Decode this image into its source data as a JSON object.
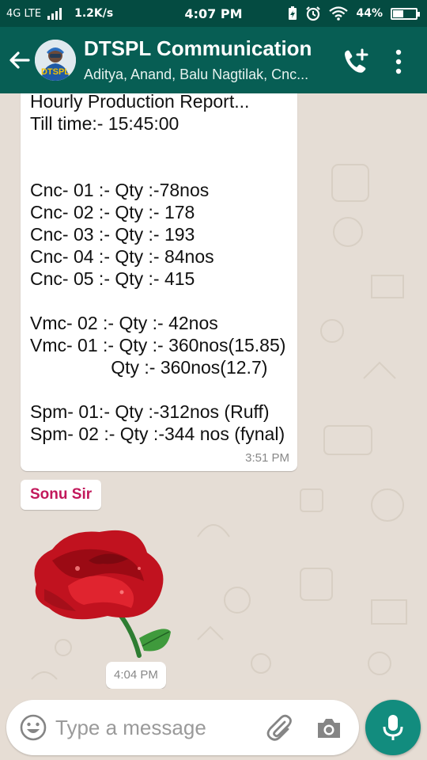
{
  "status_bar": {
    "network": "4G LTE",
    "speed": "1.2K/s",
    "time": "4:07 PM",
    "battery": "44%"
  },
  "header": {
    "title": "DTSPL Communication",
    "subtitle": "Aditya, Anand, Balu Nagtilak, Cnc...",
    "avatar_text": "DTSPL"
  },
  "messages": [
    {
      "type": "text",
      "lines": [
        "Hourly Production Report...",
        "Till time:- 15:45:00",
        "",
        "",
        "Cnc- 01 :- Qty :-78nos",
        "Cnc- 02 :- Qty :- 178",
        "Cnc- 03 :- Qty :- 193",
        "Cnc- 04 :- Qty :- 84nos",
        "Cnc- 05 :- Qty :- 415",
        "",
        "Vmc- 02 :- Qty :- 42nos",
        "Vmc- 01 :- Qty :- 360nos(15.85)",
        "                Qty :- 360nos(12.7)",
        "",
        "Spm- 01:- Qty :-312nos (Ruff)",
        "Spm- 02 :- Qty :-344 nos (fynal)"
      ],
      "time": "3:51 PM"
    },
    {
      "type": "sticker",
      "sender": "Sonu Sir",
      "sticker": "red-rose",
      "time": "4:04 PM"
    }
  ],
  "composer": {
    "placeholder": "Type a message"
  },
  "icons": {
    "back": "arrow-back-icon",
    "call": "add-call-icon",
    "menu": "more-vert-icon",
    "emoji": "emoji-icon",
    "attach": "paperclip-icon",
    "camera": "camera-icon",
    "mic": "mic-icon"
  },
  "colors": {
    "header": "#075e54",
    "status_bar": "#044b41",
    "accent": "#128c7e",
    "sender_name": "#c2185b"
  }
}
